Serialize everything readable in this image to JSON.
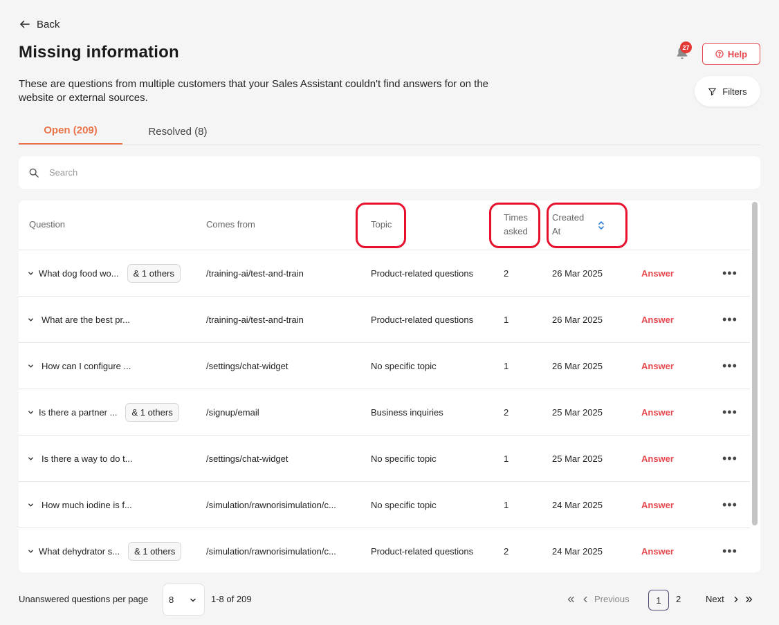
{
  "header": {
    "back_label": "Back",
    "title": "Missing information",
    "description": "These are questions from multiple customers that your Sales Assistant couldn't find answers for on the website or external sources.",
    "notification_count": "27",
    "help_label": "Help",
    "filters_label": "Filters"
  },
  "tabs": [
    {
      "label": "Open (209)",
      "active": true
    },
    {
      "label": "Resolved (8)",
      "active": false
    }
  ],
  "search": {
    "placeholder": "Search"
  },
  "table": {
    "columns": {
      "question": "Question",
      "comes_from": "Comes from",
      "topic": "Topic",
      "times_asked": "Times asked",
      "created_at": "Created At"
    },
    "rows": [
      {
        "question": "What dog food wo...",
        "others": "& 1 others",
        "comes_from": "/training-ai/test-and-train",
        "topic": "Product-related questions",
        "times": "2",
        "date": "26 Mar 2025",
        "action": "Answer"
      },
      {
        "question": "What are the best pr...",
        "others": "",
        "comes_from": "/training-ai/test-and-train",
        "topic": "Product-related questions",
        "times": "1",
        "date": "26 Mar 2025",
        "action": "Answer"
      },
      {
        "question": "How can I configure ...",
        "others": "",
        "comes_from": "/settings/chat-widget",
        "topic": "No specific topic",
        "times": "1",
        "date": "26 Mar 2025",
        "action": "Answer"
      },
      {
        "question": "Is there a partner ...",
        "others": "& 1 others",
        "comes_from": "/signup/email",
        "topic": "Business inquiries",
        "times": "2",
        "date": "25 Mar 2025",
        "action": "Answer"
      },
      {
        "question": "Is there a way to do t...",
        "others": "",
        "comes_from": "/settings/chat-widget",
        "topic": "No specific topic",
        "times": "1",
        "date": "25 Mar 2025",
        "action": "Answer"
      },
      {
        "question": "How much iodine is f...",
        "others": "",
        "comes_from": "/simulation/rawnorisimulation/c...",
        "topic": "No specific topic",
        "times": "1",
        "date": "24 Mar 2025",
        "action": "Answer"
      },
      {
        "question": "What dehydrator s...",
        "others": "& 1 others",
        "comes_from": "/simulation/rawnorisimulation/c...",
        "topic": "Product-related questions",
        "times": "2",
        "date": "24 Mar 2025",
        "action": "Answer"
      }
    ]
  },
  "footer": {
    "per_page_label": "Unanswered questions per page",
    "per_page_value": "8",
    "range": "1-8 of 209",
    "previous_label": "Previous",
    "next_label": "Next",
    "pages": [
      "1",
      "2"
    ]
  },
  "colors": {
    "accent": "#e8744a",
    "danger": "#e5484d",
    "annotation": "#e8112d"
  },
  "icons": [
    "arrow-left-icon",
    "bell-icon",
    "help-circle-icon",
    "filter-icon",
    "search-icon",
    "chevron-down-icon",
    "sort-icon",
    "more-icon",
    "chevrons-left-icon",
    "chevron-left-icon",
    "chevron-right-icon",
    "chevrons-right-icon"
  ]
}
